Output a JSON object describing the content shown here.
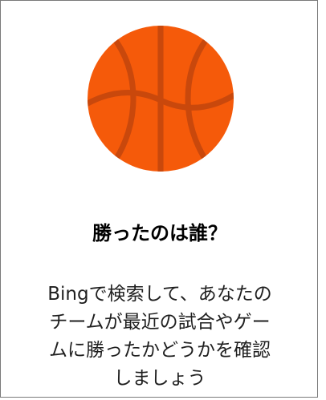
{
  "card": {
    "icon": "basketball-icon",
    "icon_colors": {
      "fill": "#f55a0a",
      "seams": "#c9480c"
    },
    "title": "勝ったのは誰？",
    "description_lines": [
      "Bingで検索して、あなたの",
      "チームが最近の試合やゲー",
      "ムに勝ったかどうかを確認",
      "しましょう"
    ]
  }
}
